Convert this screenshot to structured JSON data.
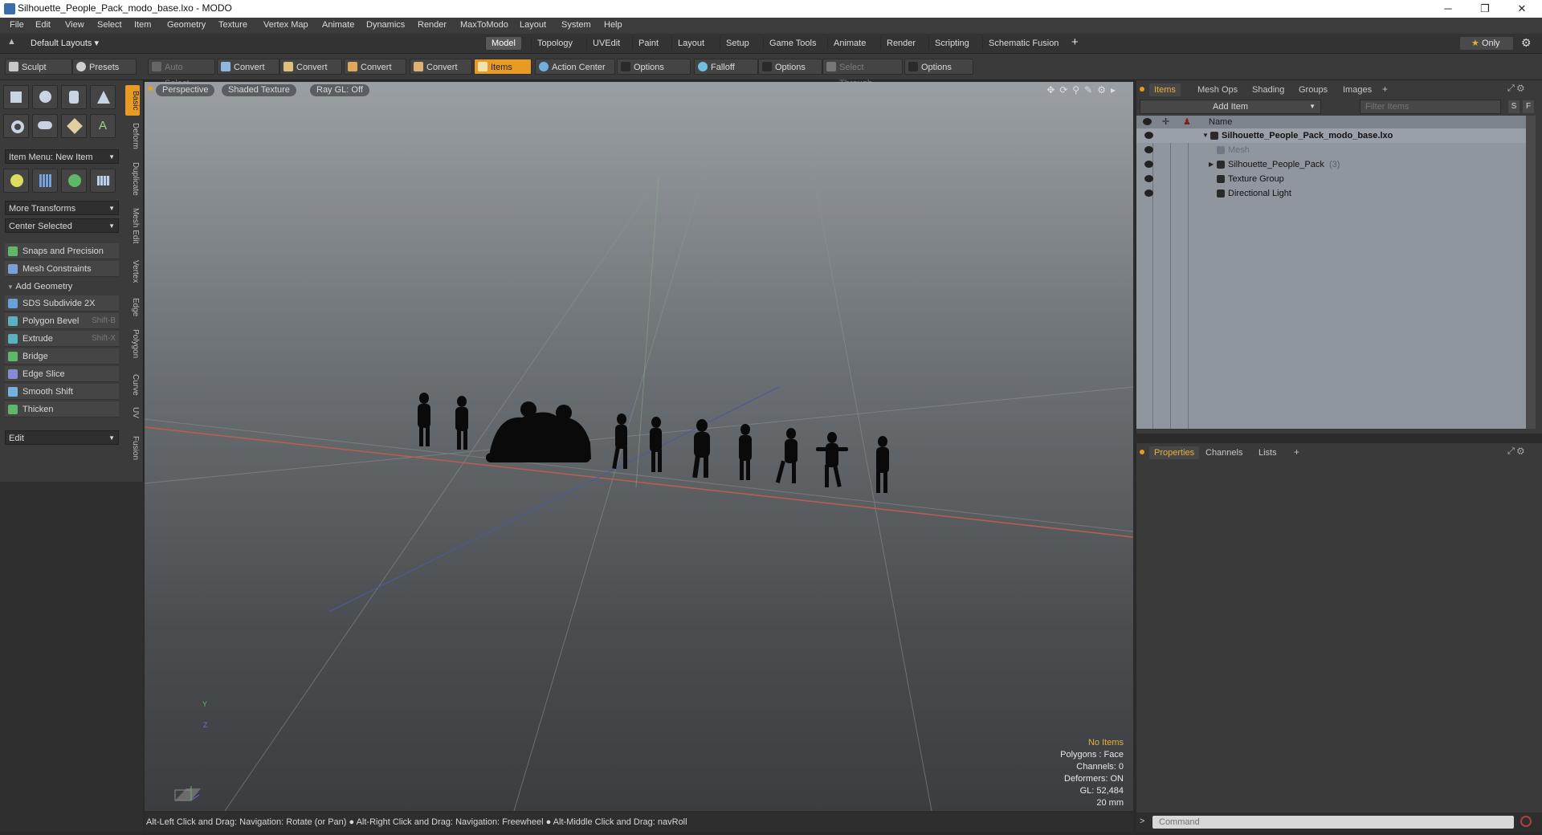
{
  "window": {
    "title": "Silhouette_People_Pack_modo_base.lxo - MODO",
    "controls": [
      "─",
      "❐",
      "✕"
    ]
  },
  "menubar": [
    "File",
    "Edit",
    "View",
    "Select",
    "Item",
    "Geometry",
    "Texture",
    "Vertex Map",
    "Animate",
    "Dynamics",
    "Render",
    "MaxToModo",
    "Layout",
    "System",
    "Help"
  ],
  "layoutbar": {
    "layout_dropdown": "Default Layouts",
    "tabs": [
      "Model",
      "Topology",
      "UVEdit",
      "Paint",
      "Layout",
      "Setup",
      "Game Tools",
      "Animate",
      "Render",
      "Scripting",
      "Schematic Fusion"
    ],
    "active_tab": "Model",
    "add_tab": "+",
    "only_label": "Only"
  },
  "toolbar": {
    "sculpt": "Sculpt",
    "presets": "Presets",
    "presets_shortcut": "F6",
    "auto_select": "Auto Select",
    "convert": "Convert",
    "items": "Items",
    "action_center": "Action Center",
    "options": "Options",
    "falloff": "Falloff",
    "select_through": "Select Through"
  },
  "leftpanel": {
    "vtabs": [
      "Basic",
      "Deform",
      "Duplicate",
      "Mesh Edit",
      "Vertex",
      "Edge",
      "Polygon",
      "Curve",
      "UV",
      "Fusion"
    ],
    "item_menu": "Item Menu: New Item",
    "more_transforms": "More Transforms",
    "center_selected": "Center Selected",
    "snaps": "Snaps and Precision",
    "mesh_constraints": "Mesh Constraints",
    "add_geometry": "Add Geometry",
    "tools": [
      {
        "label": "SDS Subdivide 2X",
        "shortcut": "",
        "color": "#6aa0d8"
      },
      {
        "label": "Polygon Bevel",
        "shortcut": "Shift-B",
        "color": "#5db0c0"
      },
      {
        "label": "Extrude",
        "shortcut": "Shift-X",
        "color": "#5db0c0"
      },
      {
        "label": "Bridge",
        "shortcut": "",
        "color": "#5fb86a"
      },
      {
        "label": "Edge Slice",
        "shortcut": "",
        "color": "#8a8ad0"
      },
      {
        "label": "Smooth Shift",
        "shortcut": "",
        "color": "#7ab0e0"
      },
      {
        "label": "Thicken",
        "shortcut": "",
        "color": "#5fb86a"
      }
    ],
    "edit": "Edit"
  },
  "viewport": {
    "view_mode": "Perspective",
    "shading": "Shaded Texture",
    "raygl": "Ray GL: Off",
    "stats": {
      "no_items": "No Items",
      "polygons": "Polygons : Face",
      "channels": "Channels: 0",
      "deformers": "Deformers: ON",
      "gl": "GL: 52,484",
      "scale": "20 mm"
    },
    "axis_y": "Y",
    "axis_z": "Z"
  },
  "statusbar": "Alt-Left Click and Drag: Navigation: Rotate (or Pan) ● Alt-Right Click and Drag: Navigation: Freewheel ● Alt-Middle Click and Drag: navRoll",
  "items_panel": {
    "tabs": [
      "Items",
      "Mesh Ops",
      "Shading",
      "Groups",
      "Images"
    ],
    "active_tab": "Items",
    "add_item": "Add Item",
    "filter_placeholder": "Filter Items",
    "filter_buttons": [
      "S",
      "F"
    ],
    "column_name": "Name",
    "tree": [
      {
        "label": "Silhouette_People_Pack_modo_base.lxo",
        "count": "",
        "bold": true
      },
      {
        "label": "Mesh",
        "count": "",
        "dim": true
      },
      {
        "label": "Silhouette_People_Pack",
        "count": "(3)"
      },
      {
        "label": "Texture Group",
        "count": ""
      },
      {
        "label": "Directional Light",
        "count": ""
      }
    ]
  },
  "props_panel": {
    "tabs": [
      "Properties",
      "Channels",
      "Lists"
    ],
    "active_tab": "Properties"
  },
  "command": {
    "prompt": ">",
    "placeholder": "Command"
  },
  "colors": {
    "accent": "#e79b25",
    "panel": "#3a3a3a",
    "tree_bg": "#8f969e"
  }
}
